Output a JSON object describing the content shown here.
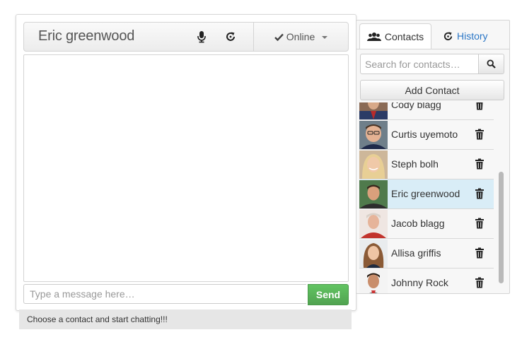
{
  "chat": {
    "title": "Eric greenwood",
    "status_label": "Online",
    "message_placeholder": "Type a message here…",
    "send_label": "Send",
    "status_bar_text": "Choose a contact and start chatting!!!"
  },
  "contacts_panel": {
    "tabs": [
      {
        "label": "Contacts",
        "icon": "users-icon",
        "active": true
      },
      {
        "label": "History",
        "icon": "history-icon",
        "active": false
      }
    ],
    "search_placeholder": "Search for contacts…",
    "add_contact_label": "Add Contact",
    "contacts": [
      {
        "name": "Cody blagg",
        "active": false
      },
      {
        "name": "Curtis uyemoto",
        "active": false
      },
      {
        "name": "Steph bolh",
        "active": false
      },
      {
        "name": "Eric greenwood",
        "active": true
      },
      {
        "name": "Jacob blagg",
        "active": false
      },
      {
        "name": "Allisa griffis",
        "active": false
      },
      {
        "name": "Johnny Rock",
        "active": false
      }
    ]
  },
  "colors": {
    "send_button": "#5cb85c",
    "active_contact": "#d9edf7",
    "history_tab_text": "#2a76c6",
    "status_bar_bg": "#e6e6e6"
  }
}
